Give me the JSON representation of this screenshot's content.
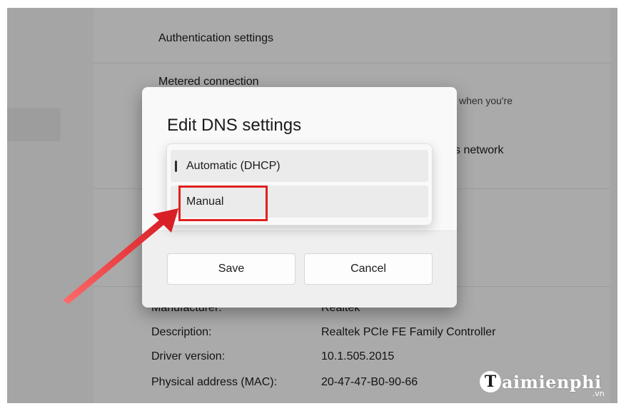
{
  "background": {
    "auth_settings": "Authentication settings",
    "metered_connection": "Metered connection",
    "metered_desc_fragment": "when you're",
    "network_fragment": "s network",
    "manufacturer_label": "Manufacturer:",
    "manufacturer_value": "Realtek",
    "description_label": "Description:",
    "description_value": "Realtek PCIe FE Family Controller",
    "driver_label": "Driver version:",
    "driver_value": "10.1.505.2015",
    "mac_label": "Physical address (MAC):",
    "mac_value": "20-47-47-B0-90-66"
  },
  "dialog": {
    "title": "Edit DNS settings",
    "options": [
      "Automatic (DHCP)",
      "Manual"
    ],
    "selected": "Automatic (DHCP)",
    "save_label": "Save",
    "cancel_label": "Cancel"
  },
  "watermark": {
    "logo_letter": "T",
    "text": "aimienphi",
    "sub": ".vn"
  },
  "colors": {
    "highlight": "#e12020",
    "arrow": "#e0262b"
  }
}
